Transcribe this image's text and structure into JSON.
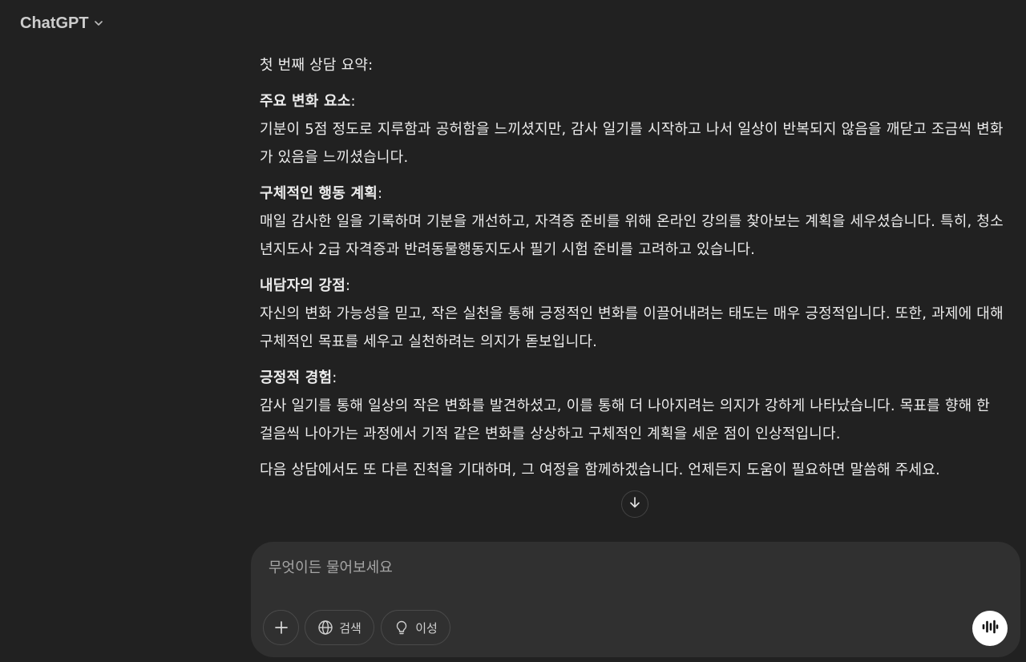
{
  "header": {
    "model_name": "ChatGPT"
  },
  "message": {
    "intro": "첫 번째 상담 요약:",
    "sections": [
      {
        "heading": "주요 변화 요소",
        "body": "기분이 5점 정도로 지루함과 공허함을 느끼셨지만, 감사 일기를 시작하고 나서 일상이 반복되지 않음을 깨닫고 조금씩 변화가 있음을 느끼셨습니다."
      },
      {
        "heading": "구체적인 행동 계획",
        "body": "매일 감사한 일을 기록하며 기분을 개선하고, 자격증 준비를 위해 온라인 강의를 찾아보는 계획을 세우셨습니다. 특히, 청소년지도사 2급 자격증과 반려동물행동지도사 필기 시험 준비를 고려하고 있습니다."
      },
      {
        "heading": "내담자의 강점",
        "body": "자신의 변화 가능성을 믿고, 작은 실천을 통해 긍정적인 변화를 이끌어내려는 태도는 매우 긍정적입니다. 또한, 과제에 대해 구체적인 목표를 세우고 실천하려는 의지가 돋보입니다."
      },
      {
        "heading": "긍정적 경험",
        "body": "감사 일기를 통해 일상의 작은 변화를 발견하셨고, 이를 통해 더 나아지려는 의지가 강하게 나타났습니다. 목표를 향해 한 걸음씩 나아가는 과정에서 기적 같은 변화를 상상하고 구체적인 계획을 세운 점이 인상적입니다."
      }
    ],
    "closing": "다음 상담에서도 또 다른 진척을 기대하며, 그 여정을 함께하겠습니다. 언제든지 도움이 필요하면 말씀해 주세요."
  },
  "composer": {
    "placeholder": "무엇이든 물어보세요",
    "value": "",
    "search_label": "검색",
    "reason_label": "이성"
  },
  "icons": {
    "model_chevron": "chevron-down-icon",
    "scroll": "arrow-down-icon",
    "attach": "plus-icon",
    "search": "globe-icon",
    "reason": "lightbulb-icon",
    "voice": "voice-wave-icon"
  },
  "colors": {
    "background": "#212121",
    "composer": "#303030",
    "text": "#ececec",
    "voice_button": "#ffffff"
  }
}
